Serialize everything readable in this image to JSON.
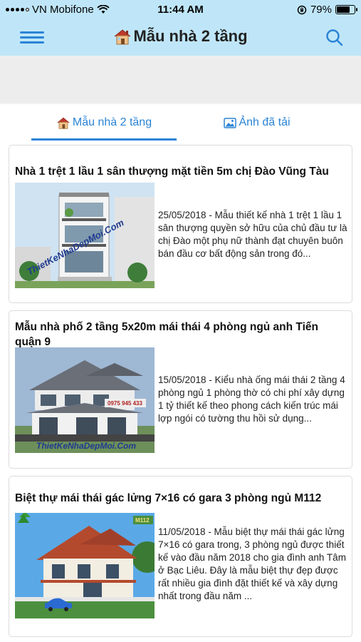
{
  "status_bar": {
    "carrier": "VN Mobifone",
    "time": "11:44 AM",
    "battery_percent": "79%",
    "battery_level": 0.79
  },
  "header": {
    "title": "Mẫu nhà 2 tầng",
    "title_icon": "house-icon",
    "menu_icon": "hamburger-menu-icon",
    "search_icon": "search-icon"
  },
  "tabs": [
    {
      "label": "Mẫu nhà 2 tầng",
      "icon": "house-icon",
      "active": true
    },
    {
      "label": "Ảnh đã tải",
      "icon": "image-icon",
      "active": false
    }
  ],
  "colors": {
    "accent": "#2a84d6",
    "header_bg": "#bfe6f8"
  },
  "articles": [
    {
      "title": "Nhà 1 trệt 1 lầu 1 sân thượng mặt tiền 5m chị Đào Vũng Tàu",
      "excerpt": "25/05/2018 - Mẫu thiết kế nhà 1 trệt 1 lầu 1 sân thượng quyền sở hữu của chủ đầu tư là chị Đào một phụ nữ thành đạt chuyên buôn bán đầu cơ bất động sản trong đó...",
      "watermark": "ThietKeNhaDepMoi.Com"
    },
    {
      "title": "Mẫu nhà phố 2 tầng 5x20m mái thái 4 phòng ngủ anh Tiến quận 9",
      "excerpt": "15/05/2018 - Kiểu nhà ống mái thái 2 tầng 4 phòng ngủ 1 phòng thờ có chi phí xây dựng 1 tỷ thiết kế theo phong cách kiến trúc mái lợp ngói có tường thu hồi sử dụng...",
      "watermark": "ThietKeNhaDepMoi.Com",
      "phone": "0975 945 433"
    },
    {
      "title": "Biệt thự mái thái gác lửng 7×16 có gara 3 phòng ngủ M112",
      "excerpt": "11/05/2018 - Mẫu biệt thự mái thái gác lửng 7×16 có gara trong, 3 phòng ngủ được thiết kế vào đầu năm 2018 cho gia đình anh Tâm ở Bạc Liêu. Đây là mẫu biệt thự đẹp được rất nhiều gia đình đặt thiết kế và xây dựng nhất trong đầu năm ...",
      "badge": "M112"
    }
  ]
}
